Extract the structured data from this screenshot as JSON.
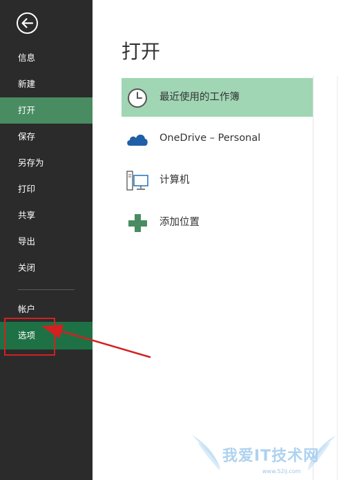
{
  "sidebar": {
    "items": [
      {
        "label": "信息"
      },
      {
        "label": "新建"
      },
      {
        "label": "打开"
      },
      {
        "label": "保存"
      },
      {
        "label": "另存为"
      },
      {
        "label": "打印"
      },
      {
        "label": "共享"
      },
      {
        "label": "导出"
      },
      {
        "label": "关闭"
      },
      {
        "label": "帐户"
      },
      {
        "label": "选项"
      }
    ]
  },
  "main": {
    "title": "打开",
    "places": [
      {
        "label": "最近使用的工作簿",
        "icon": "clock-icon"
      },
      {
        "label": "OneDrive – Personal",
        "icon": "cloud-icon"
      },
      {
        "label": "计算机",
        "icon": "computer-icon"
      },
      {
        "label": "添加位置",
        "icon": "plus-icon"
      }
    ]
  },
  "watermark": {
    "text": "我爱IT技术网",
    "url": "www.52ij.com"
  },
  "colors": {
    "sidebar_bg": "#2b2b2b",
    "active_item": "#4a8c62",
    "options_bg": "#1e7145",
    "selected_place": "#a0d6b4",
    "annotation_red": "#d42020"
  }
}
